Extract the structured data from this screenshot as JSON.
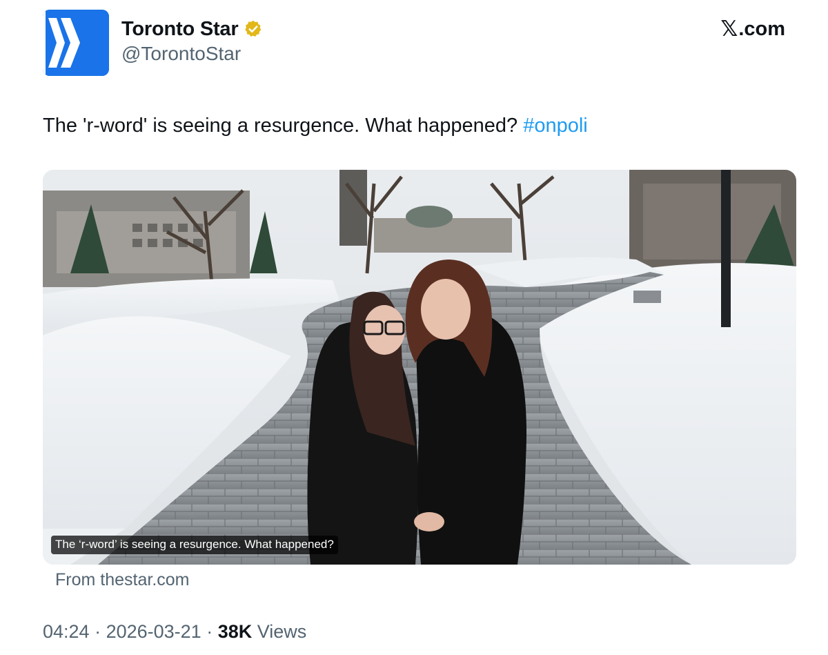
{
  "author": {
    "display_name": "Toronto Star",
    "handle": "@TorontoStar",
    "verified_icon": "verified-badge-icon",
    "avatar_color": "#1a73e8"
  },
  "brand": {
    "logo": "x-logo-icon",
    "label": ".com"
  },
  "tweet": {
    "text": "The 'r-word' is seeing a resurgence. What happened? ",
    "hashtag": "#onpoli",
    "hashtag_color": "#1d9bf0"
  },
  "card": {
    "image_alt": "Two women in black winter coats standing on a snowy paved campus path",
    "caption": "The ‘r-word’ is seeing a resurgence. What happened?",
    "source": "From thestar.com"
  },
  "meta": {
    "time": "04:24",
    "separator1": " · ",
    "date": "2026-03-21",
    "separator2": " · ",
    "views_count": "38K",
    "views_label": " Views"
  }
}
